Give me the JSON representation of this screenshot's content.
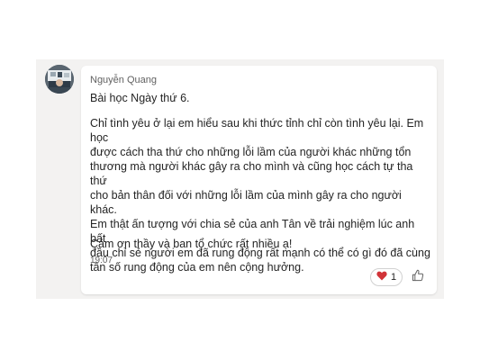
{
  "message": {
    "sender": "Nguyễn Quang",
    "title": "Bài học Ngày thứ 6.",
    "body_lines": [
      "Chỉ tình yêu ở lại em hiểu sau khi thức tỉnh chỉ còn tình yêu lại. Em học",
      "được cách tha thứ cho những lỗi lầm của người khác những tổn",
      "thương mà người khác gây ra cho mình và cũng học cách tự tha thứ",
      "cho bản thân đối với những lỗi lầm của mình gây ra cho người khác.",
      "Em thật ấn tượng với chia sẻ của anh Tân về trải nghiệm lúc anh bất",
      "đầu chỉ sẻ người em đã rung động rất mạnh có thể có gì đó đã cùng",
      "tần số rung động của em nên cộng hưởng."
    ],
    "thanks": "Cảm ơn thầy và ban tổ chức rất nhiều ạ!",
    "timestamp": "19:07"
  },
  "reactions": {
    "heart_icon": "heart-icon",
    "heart_color": "#d13438",
    "count": "1",
    "like_icon": "thumbs-up-icon"
  },
  "colors": {
    "chat_background": "#f3f2f1",
    "bubble_background": "#ffffff",
    "text": "#242424",
    "secondary_text": "#616161"
  }
}
